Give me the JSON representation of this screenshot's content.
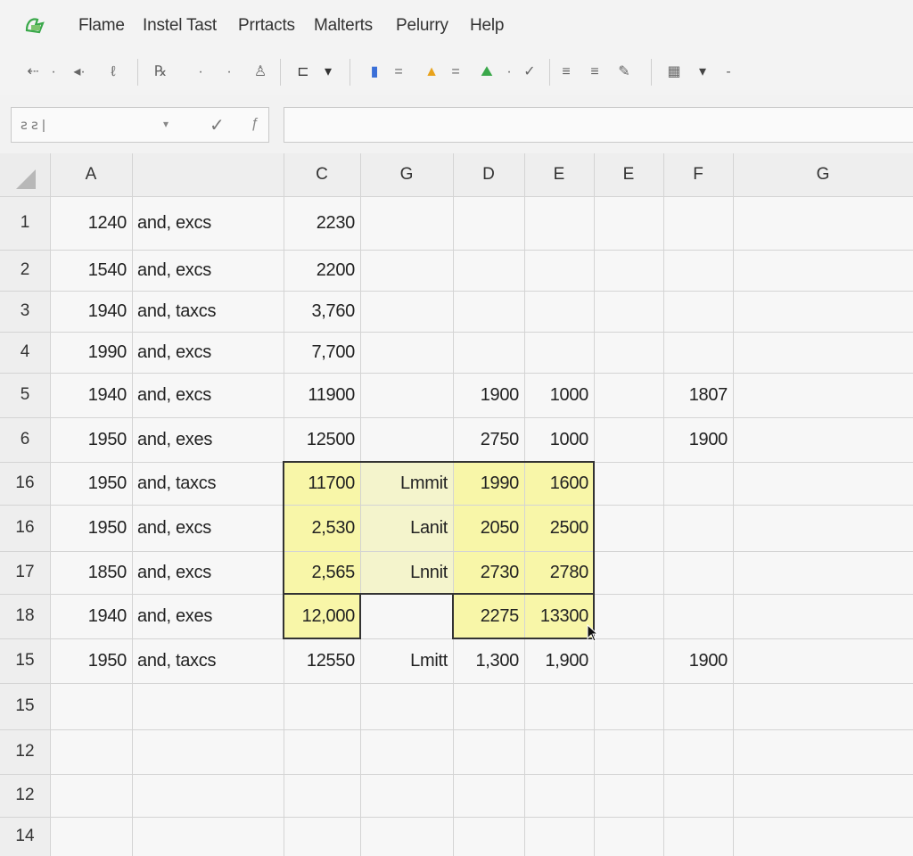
{
  "menu": [
    "Flame",
    "Instel Tast",
    "Prrtacts",
    "Malterts",
    "Pelurry",
    "Help"
  ],
  "toolbar": {
    "items": [
      "⇠",
      "·",
      "◂·",
      "ℓ",
      "℞",
      "·",
      "·",
      "♙",
      "⊏",
      "▾",
      "▮",
      "=",
      "▲",
      "=",
      "⛰",
      "·",
      "✓",
      "≡",
      "≡",
      "✎",
      "▦",
      "▾",
      "-"
    ]
  },
  "formula_bar": {
    "name_box": "ꙅ ꙅ |",
    "dropdown": "▾",
    "check": "✓",
    "fx": "ƒ",
    "value": ""
  },
  "columns": [
    "A",
    "",
    "C",
    "G",
    "D",
    "E",
    "E",
    "F",
    "G"
  ],
  "rows": [
    {
      "num": "1",
      "a": "1240",
      "b": "and, excs",
      "c": "2230",
      "g": "",
      "d": "",
      "e": "",
      "e2": "",
      "f": ""
    },
    {
      "num": "2",
      "a": "1540",
      "b": "and, excs",
      "c": "2200",
      "g": "",
      "d": "",
      "e": "",
      "e2": "",
      "f": ""
    },
    {
      "num": "3",
      "a": "1940",
      "b": "and, taxcs",
      "c": "3,760",
      "g": "",
      "d": "",
      "e": "",
      "e2": "",
      "f": ""
    },
    {
      "num": "4",
      "a": "1990",
      "b": "and, excs",
      "c": "7,700",
      "g": "",
      "d": "",
      "e": "",
      "e2": "",
      "f": ""
    },
    {
      "num": "5",
      "a": "1940",
      "b": "and, excs",
      "c": "11900",
      "g": "",
      "d": "1900",
      "e": "1000",
      "e2": "",
      "f": "1807"
    },
    {
      "num": "6",
      "a": "1950",
      "b": "and, exes",
      "c": "12500",
      "g": "",
      "d": "2750",
      "e": "1000",
      "e2": "",
      "f": "1900"
    },
    {
      "num": "16",
      "a": "1950",
      "b": "and, taxcs",
      "c": "11700",
      "g": "Lmmit",
      "d": "1990",
      "e": "1600",
      "e2": "",
      "f": ""
    },
    {
      "num": "16",
      "a": "1950",
      "b": "and, excs",
      "c": "2,530",
      "g": "Lanit",
      "d": "2050",
      "e": "2500",
      "e2": "",
      "f": ""
    },
    {
      "num": "17",
      "a": "1850",
      "b": "and, excs",
      "c": "2,565",
      "g": "Lnnit",
      "d": "2730",
      "e": "2780",
      "e2": "",
      "f": ""
    },
    {
      "num": "18",
      "a": "1940",
      "b": "and, exes",
      "c": "12,000",
      "g": "",
      "d": "2275",
      "e": "13300",
      "e2": "",
      "f": ""
    },
    {
      "num": "15",
      "a": "1950",
      "b": "and, taxcs",
      "c": "12550",
      "g": "Lmitt",
      "d": "1,300",
      "e": "1,900",
      "e2": "",
      "f": "1900"
    },
    {
      "num": "15",
      "a": "",
      "b": "",
      "c": "",
      "g": "",
      "d": "",
      "e": "",
      "e2": "",
      "f": ""
    },
    {
      "num": "12",
      "a": "",
      "b": "",
      "c": "",
      "g": "",
      "d": "",
      "e": "",
      "e2": "",
      "f": ""
    },
    {
      "num": "12",
      "a": "",
      "b": "",
      "c": "",
      "g": "",
      "d": "",
      "e": "",
      "e2": "",
      "f": ""
    },
    {
      "num": "14",
      "a": "",
      "b": "",
      "c": "",
      "g": "",
      "d": "",
      "e": "",
      "e2": "",
      "f": ""
    }
  ],
  "colors": {
    "highlight": "#f8f6a8",
    "grid_line": "#d4d4d4",
    "logo_green": "#3aa84a"
  }
}
